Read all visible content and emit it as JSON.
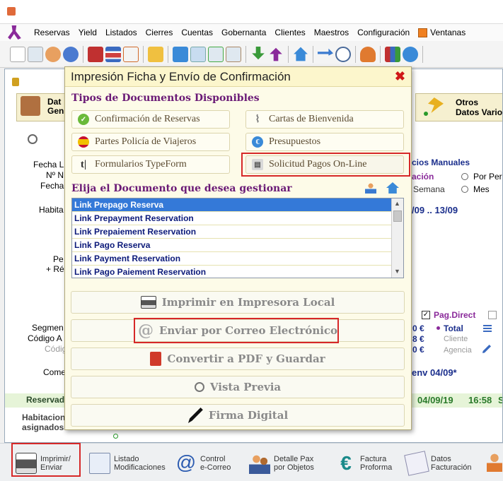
{
  "menu": [
    "Reservas",
    "Yield",
    "Listados",
    "Cierres",
    "Cuentas",
    "Gobernanta",
    "Clientes",
    "Maestros",
    "Configuración",
    "Ventanas"
  ],
  "background": {
    "tab_left": "Dat\nGen",
    "tab_right_line1": "Otros",
    "tab_right_line2": "Datos Vario",
    "labels_left": [
      "Fecha Ll",
      "Nº N",
      "Fecha",
      "Habita",
      "Pe",
      "+ Ré",
      "Segmen",
      "Código A",
      "Códig",
      "Come"
    ],
    "precios_manuales": "cios Manuales",
    "acion": "ación",
    "por_per": "Por Per",
    "semana": "Semana",
    "mes": "Mes",
    "dates_range": "/09 ..  13/09",
    "pag_direct": "Pag.Direct",
    "amt1": "0 €",
    "amt2": "8 €",
    "amt3": "0 €",
    "total": "Total",
    "cliente": "Cliente",
    "agencia": "Agencia",
    "env": "env 04/09*",
    "reservado": "Reservad",
    "status_date": "04/09/19",
    "status_time": "16:58",
    "status_s": "S",
    "habitaciones": "Habitacion",
    "asignados": "asignados"
  },
  "dialog": {
    "title": "Impresión Ficha y Envío de Confirmación",
    "section1": "Tipos de Documentos Disponibles",
    "doc_types": [
      {
        "label": "Confirmación de Reservas",
        "icon": "check-icon"
      },
      {
        "label": "Cartas de Bienvenida",
        "icon": "paperclip-icon"
      },
      {
        "label": "Partes Policía de Viajeros",
        "icon": "spain-flag-icon"
      },
      {
        "label": "Presupuestos",
        "icon": "euro-icon"
      },
      {
        "label": "Formularios TypeForm",
        "icon": "typeform-icon"
      },
      {
        "label": "Solicitud Pagos On-Line",
        "icon": "payment-icon"
      }
    ],
    "section2": "Elija el Documento que desea gestionar",
    "documents": [
      "Link Prepago Reserva",
      "Link Prepayment Reservation",
      "Link Prepaiement Reservation",
      "Link Pago Reserva",
      "Link Payment Reservation",
      "Link Pago Paiement Reservation"
    ],
    "actions": [
      {
        "label": "Imprimir en Impresora Local",
        "icon": "printer-icon"
      },
      {
        "label": "Enviar por Correo Electrónico",
        "icon": "email-at-icon"
      },
      {
        "label": "Convertir a PDF y Guardar",
        "icon": "pdf-icon"
      },
      {
        "label": "Vista Previa",
        "icon": "magnifier-icon"
      },
      {
        "label": "Firma Digital",
        "icon": "pen-icon"
      }
    ]
  },
  "bottom_toolbar": [
    {
      "line1": "Imprimir/",
      "line2": "Enviar",
      "icon": "printer-icon"
    },
    {
      "line1": "Listado",
      "line2": "Modificaciones",
      "icon": "checklist-icon"
    },
    {
      "line1": "Control",
      "line2": "e-Correo",
      "icon": "at-icon"
    },
    {
      "line1": "Detalle Pax",
      "line2": "por Objetos",
      "icon": "people-icon"
    },
    {
      "line1": "Factura",
      "line2": "Proforma",
      "icon": "euro-icon"
    },
    {
      "line1": "Datos",
      "line2": "Facturación",
      "icon": "billing-icon"
    }
  ]
}
